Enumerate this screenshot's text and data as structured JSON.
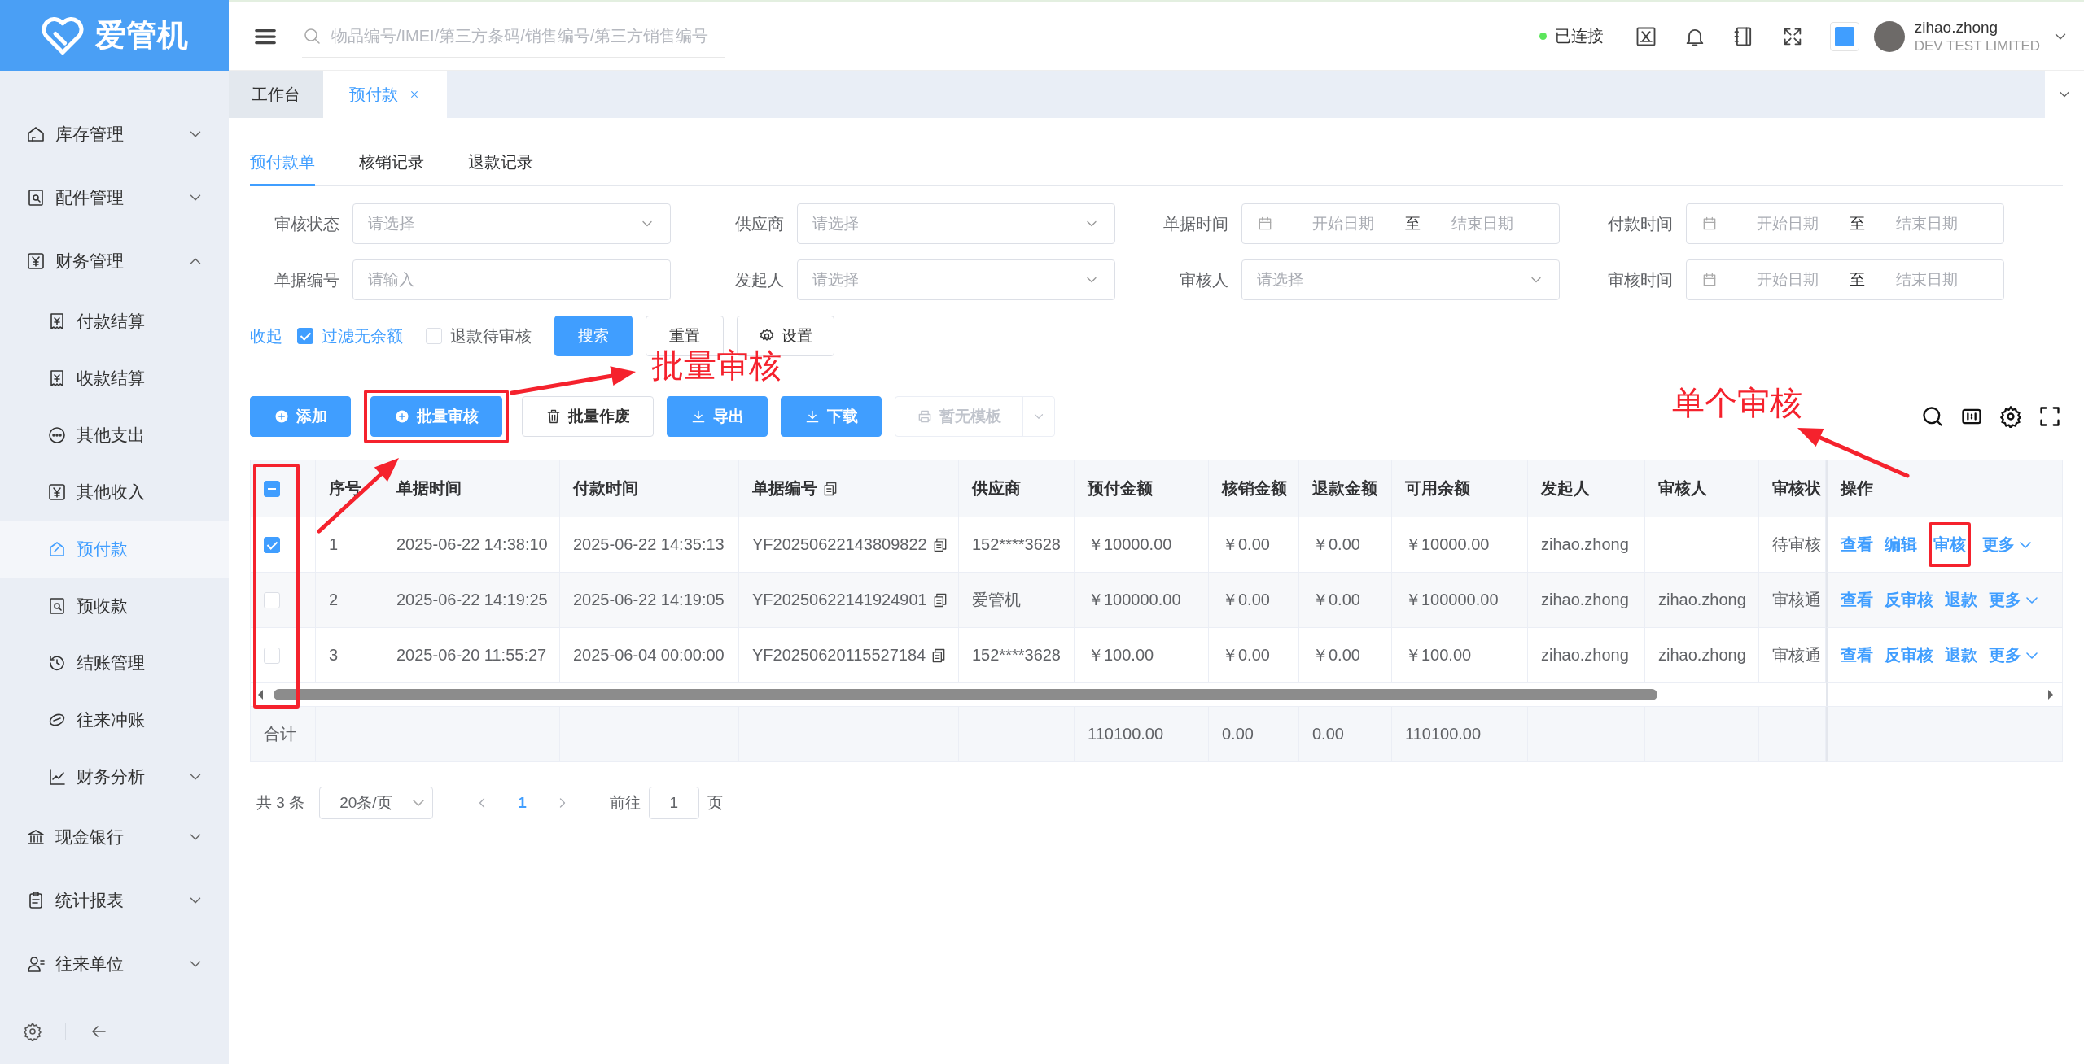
{
  "sidebar": {
    "logo": "爱管机",
    "items": [
      {
        "label": "库存管理",
        "expanded": false,
        "selected": false
      },
      {
        "label": "配件管理",
        "expanded": false,
        "selected": false
      },
      {
        "label": "财务管理",
        "expanded": true,
        "selected": false,
        "children": [
          {
            "label": "付款结算",
            "selected": false
          },
          {
            "label": "收款结算",
            "selected": false
          },
          {
            "label": "其他支出",
            "selected": false
          },
          {
            "label": "其他收入",
            "selected": false
          },
          {
            "label": "预付款",
            "selected": true
          },
          {
            "label": "预收款",
            "selected": false
          },
          {
            "label": "结账管理",
            "selected": false
          },
          {
            "label": "往来冲账",
            "selected": false
          },
          {
            "label": "财务分析",
            "expanded": false,
            "selected": false
          }
        ]
      },
      {
        "label": "现金银行",
        "expanded": false,
        "selected": false
      },
      {
        "label": "统计报表",
        "expanded": false,
        "selected": false
      },
      {
        "label": "往来单位",
        "expanded": false,
        "selected": false
      }
    ]
  },
  "header": {
    "search": {
      "placeholder": "物品编号/IMEI/第三方条码/销售编号/第三方销售编号"
    },
    "connection": {
      "label": "已连接",
      "connected": true
    },
    "user": {
      "name": "zihao.zhong",
      "company": "DEV TEST LIMITED"
    }
  },
  "page_tabs": [
    {
      "label": "工作台",
      "selected": false,
      "closable": false
    },
    {
      "label": "预付款",
      "selected": true,
      "closable": true
    }
  ],
  "sub_tabs": [
    {
      "label": "预付款单",
      "selected": true
    },
    {
      "label": "核销记录",
      "selected": false
    },
    {
      "label": "退款记录",
      "selected": false
    }
  ],
  "filters": [
    {
      "label": "审核状态",
      "kind": "select",
      "placeholder": "请选择"
    },
    {
      "label": "供应商",
      "kind": "select",
      "placeholder": "请选择"
    },
    {
      "label": "单据时间",
      "kind": "daterange",
      "start_placeholder": "开始日期",
      "separator": "至",
      "end_placeholder": "结束日期"
    },
    {
      "label": "付款时间",
      "kind": "daterange",
      "start_placeholder": "开始日期",
      "separator": "至",
      "end_placeholder": "结束日期"
    },
    {
      "label": "单据编号",
      "kind": "input",
      "placeholder": "请输入"
    },
    {
      "label": "发起人",
      "kind": "select",
      "placeholder": "请选择"
    },
    {
      "label": "审核人",
      "kind": "select",
      "placeholder": "请选择"
    },
    {
      "label": "审核时间",
      "kind": "daterange",
      "start_placeholder": "开始日期",
      "separator": "至",
      "end_placeholder": "结束日期"
    }
  ],
  "filter_bar": {
    "collapse_link": "收起",
    "checkboxes": [
      {
        "label": "过滤无余额",
        "checked": true
      },
      {
        "label": "退款待审核",
        "checked": false
      }
    ],
    "buttons": [
      {
        "label": "搜索",
        "kind": "primary"
      },
      {
        "label": "重置",
        "kind": "plain"
      },
      {
        "label": "设置",
        "kind": "settings"
      }
    ]
  },
  "toolbar": {
    "buttons": [
      {
        "label": "添加",
        "kind": "add",
        "disabled": false,
        "highlighted": false
      },
      {
        "label": "批量审核",
        "kind": "add",
        "disabled": false,
        "highlighted": true
      },
      {
        "label": "批量作废",
        "kind": "delete",
        "disabled": false,
        "highlighted": false
      },
      {
        "label": "导出",
        "kind": "download",
        "disabled": false,
        "highlighted": false
      },
      {
        "label": "下载",
        "kind": "download",
        "disabled": false,
        "highlighted": false
      },
      {
        "label": "暂无模板",
        "kind": "print",
        "disabled": true,
        "highlighted": false
      }
    ]
  },
  "table": {
    "select_all_indeterminate": true,
    "selection_column_highlighted": true,
    "footer_label": "合计",
    "columns": [
      {
        "label": "序号",
        "kind": "text"
      },
      {
        "label": "单据时间",
        "kind": "text"
      },
      {
        "label": "付款时间",
        "kind": "text"
      },
      {
        "label": "单据编号",
        "kind": "copy"
      },
      {
        "label": "供应商",
        "kind": "text"
      },
      {
        "label": "预付金额",
        "kind": "text",
        "total": "110100.00"
      },
      {
        "label": "核销金额",
        "kind": "text",
        "total": "0.00"
      },
      {
        "label": "退款金额",
        "kind": "text",
        "total": "0.00"
      },
      {
        "label": "可用余额",
        "kind": "text",
        "total": "110100.00"
      },
      {
        "label": "发起人",
        "kind": "text"
      },
      {
        "label": "审核人",
        "kind": "text"
      },
      {
        "label": "审核状",
        "kind": "text"
      },
      {
        "label": "操作",
        "kind": "actions"
      }
    ],
    "rows": [
      {
        "selected": true,
        "cells": [
          "1",
          "2025-06-22 14:38:10",
          "2025-06-22 14:35:13",
          "YF20250622143809822",
          "152****3628",
          "￥10000.00",
          "￥0.00",
          "￥0.00",
          "￥10000.00",
          "zihao.zhong",
          {
            "kind": "empty"
          },
          "待审核"
        ],
        "actions": [
          {
            "label": "查看",
            "kind": "link",
            "highlighted": false
          },
          {
            "label": "编辑",
            "kind": "link",
            "highlighted": false
          },
          {
            "label": "审核",
            "kind": "link",
            "highlighted": true
          },
          {
            "label": "更多",
            "kind": "more",
            "highlighted": false
          }
        ]
      },
      {
        "selected": false,
        "cells": [
          "2",
          "2025-06-22 14:19:25",
          "2025-06-22 14:19:05",
          "YF20250622141924901",
          "爱管机",
          "￥100000.00",
          "￥0.00",
          "￥0.00",
          "￥100000.00",
          "zihao.zhong",
          "zihao.zhong",
          "审核通"
        ],
        "actions": [
          {
            "label": "查看",
            "kind": "link",
            "highlighted": false
          },
          {
            "label": "反审核",
            "kind": "link",
            "highlighted": false
          },
          {
            "label": "退款",
            "kind": "link",
            "highlighted": false
          },
          {
            "label": "更多",
            "kind": "more",
            "highlighted": false
          }
        ]
      },
      {
        "selected": false,
        "cells": [
          "3",
          "2025-06-20 11:55:27",
          "2025-06-04 00:00:00",
          "YF20250620115527184",
          "152****3628",
          "￥100.00",
          "￥0.00",
          "￥0.00",
          "￥100.00",
          "zihao.zhong",
          "zihao.zhong",
          "审核通"
        ],
        "actions": [
          {
            "label": "查看",
            "kind": "link",
            "highlighted": false
          },
          {
            "label": "反审核",
            "kind": "link",
            "highlighted": false
          },
          {
            "label": "退款",
            "kind": "link",
            "highlighted": false
          },
          {
            "label": "更多",
            "kind": "more",
            "highlighted": false
          }
        ]
      }
    ]
  },
  "pagination": {
    "total": "共 3 条",
    "page_size": "20条/页",
    "pages": [
      {
        "label": "1",
        "selected": true
      }
    ],
    "goto_label": "前往",
    "goto_value": "1",
    "goto_suffix": "页"
  },
  "annotations": [
    {
      "text": "批量审核"
    },
    {
      "text": "单个审核"
    }
  ]
}
